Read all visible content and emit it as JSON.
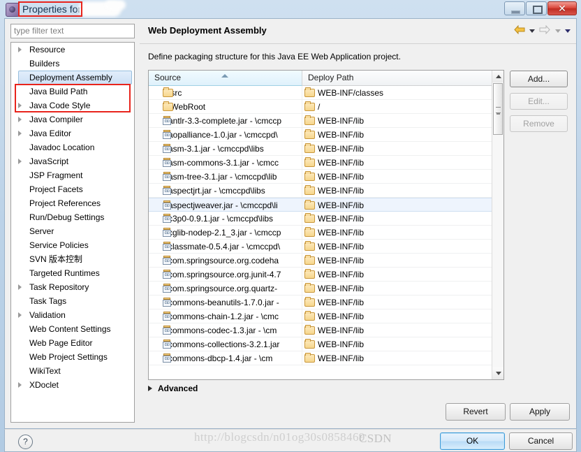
{
  "window": {
    "title": "Properties for",
    "icon": "eclipse-properties-icon",
    "buttons": {
      "minimize": "minimize-button",
      "maximize": "maximize-button",
      "close": "✕"
    }
  },
  "sidebar": {
    "filter_placeholder": "type filter text",
    "filter_value": "",
    "items": [
      {
        "label": "Resource",
        "expandable": true,
        "selected": false
      },
      {
        "label": "Builders",
        "expandable": false,
        "selected": false
      },
      {
        "label": "Deployment Assembly",
        "expandable": false,
        "selected": true
      },
      {
        "label": "Java Build Path",
        "expandable": false,
        "selected": false
      },
      {
        "label": "Java Code Style",
        "expandable": true,
        "selected": false
      },
      {
        "label": "Java Compiler",
        "expandable": true,
        "selected": false
      },
      {
        "label": "Java Editor",
        "expandable": true,
        "selected": false
      },
      {
        "label": "Javadoc Location",
        "expandable": false,
        "selected": false
      },
      {
        "label": "JavaScript",
        "expandable": true,
        "selected": false
      },
      {
        "label": "JSP Fragment",
        "expandable": false,
        "selected": false
      },
      {
        "label": "Project Facets",
        "expandable": false,
        "selected": false
      },
      {
        "label": "Project References",
        "expandable": false,
        "selected": false
      },
      {
        "label": "Run/Debug Settings",
        "expandable": false,
        "selected": false
      },
      {
        "label": "Server",
        "expandable": false,
        "selected": false
      },
      {
        "label": "Service Policies",
        "expandable": false,
        "selected": false
      },
      {
        "label": "SVN 版本控制",
        "expandable": false,
        "selected": false
      },
      {
        "label": "Targeted Runtimes",
        "expandable": false,
        "selected": false
      },
      {
        "label": "Task Repository",
        "expandable": true,
        "selected": false
      },
      {
        "label": "Task Tags",
        "expandable": false,
        "selected": false
      },
      {
        "label": "Validation",
        "expandable": true,
        "selected": false
      },
      {
        "label": "Web Content Settings",
        "expandable": false,
        "selected": false
      },
      {
        "label": "Web Page Editor",
        "expandable": false,
        "selected": false
      },
      {
        "label": "Web Project Settings",
        "expandable": false,
        "selected": false
      },
      {
        "label": "WikiText",
        "expandable": false,
        "selected": false
      },
      {
        "label": "XDoclet",
        "expandable": true,
        "selected": false
      }
    ]
  },
  "page": {
    "title": "Web Deployment Assembly",
    "description": "Define packaging structure for this Java EE Web Application project.",
    "nav": {
      "back": "back-arrow-icon",
      "forward": "forward-arrow-icon",
      "menu": "view-menu-icon"
    }
  },
  "table": {
    "columns": [
      "Source",
      "Deploy Path"
    ],
    "sort_column": "Source",
    "sort_direction": "ascending",
    "rows": [
      {
        "source": "/src",
        "deploy": "WEB-INF/classes",
        "icon": "folder-icon",
        "selected": false
      },
      {
        "source": "/WebRoot",
        "deploy": "/",
        "icon": "folder-icon",
        "selected": false
      },
      {
        "source": "antlr-3.3-complete.jar - \\cmccp",
        "deploy": "WEB-INF/lib",
        "icon": "jar-icon",
        "selected": false
      },
      {
        "source": "aopalliance-1.0.jar - \\cmccpd\\",
        "deploy": "WEB-INF/lib",
        "icon": "jar-icon",
        "selected": false
      },
      {
        "source": "asm-3.1.jar - \\cmccpd\\libs",
        "deploy": "WEB-INF/lib",
        "icon": "jar-icon",
        "selected": false
      },
      {
        "source": "asm-commons-3.1.jar - \\cmcc",
        "deploy": "WEB-INF/lib",
        "icon": "jar-icon",
        "selected": false
      },
      {
        "source": "asm-tree-3.1.jar - \\cmccpd\\lib",
        "deploy": "WEB-INF/lib",
        "icon": "jar-icon",
        "selected": false
      },
      {
        "source": "aspectjrt.jar - \\cmccpd\\libs",
        "deploy": "WEB-INF/lib",
        "icon": "jar-icon",
        "selected": false
      },
      {
        "source": "aspectjweaver.jar - \\cmccpd\\li",
        "deploy": "WEB-INF/lib",
        "icon": "jar-icon",
        "selected": true
      },
      {
        "source": "c3p0-0.9.1.jar - \\cmccpd\\libs",
        "deploy": "WEB-INF/lib",
        "icon": "jar-icon",
        "selected": false
      },
      {
        "source": "cglib-nodep-2.1_3.jar - \\cmccp",
        "deploy": "WEB-INF/lib",
        "icon": "jar-icon",
        "selected": false
      },
      {
        "source": "classmate-0.5.4.jar - \\cmccpd\\",
        "deploy": "WEB-INF/lib",
        "icon": "jar-icon",
        "selected": false
      },
      {
        "source": "com.springsource.org.codeha",
        "deploy": "WEB-INF/lib",
        "icon": "jar-icon",
        "selected": false
      },
      {
        "source": "com.springsource.org.junit-4.7",
        "deploy": "WEB-INF/lib",
        "icon": "jar-icon",
        "selected": false
      },
      {
        "source": "com.springsource.org.quartz-",
        "deploy": "WEB-INF/lib",
        "icon": "jar-icon",
        "selected": false
      },
      {
        "source": "commons-beanutils-1.7.0.jar - ",
        "deploy": "WEB-INF/lib",
        "icon": "jar-icon",
        "selected": false
      },
      {
        "source": "commons-chain-1.2.jar - \\cmc",
        "deploy": "WEB-INF/lib",
        "icon": "jar-icon",
        "selected": false
      },
      {
        "source": "commons-codec-1.3.jar - \\cm",
        "deploy": "WEB-INF/lib",
        "icon": "jar-icon",
        "selected": false
      },
      {
        "source": "commons-collections-3.2.1.jar",
        "deploy": "WEB-INF/lib",
        "icon": "jar-icon",
        "selected": false
      },
      {
        "source": "commons-dbcp-1.4.jar - \\cm",
        "deploy": "WEB-INF/lib",
        "icon": "jar-icon",
        "selected": false
      }
    ]
  },
  "side_buttons": [
    {
      "label": "Add...",
      "enabled": true
    },
    {
      "label": "Edit...",
      "enabled": false
    },
    {
      "label": "Remove",
      "enabled": false
    }
  ],
  "advanced": {
    "label": "Advanced",
    "expanded": false
  },
  "page_buttons": {
    "revert": "Revert",
    "apply": "Apply"
  },
  "footer": {
    "help": "?",
    "ok": "OK",
    "cancel": "Cancel",
    "watermark": "http://blogcsdn/n01og30s0858469",
    "watermark2": "CSDN"
  },
  "annotations": {
    "title_box_color": "#e8241c",
    "tree_box_color": "#e8241c"
  }
}
